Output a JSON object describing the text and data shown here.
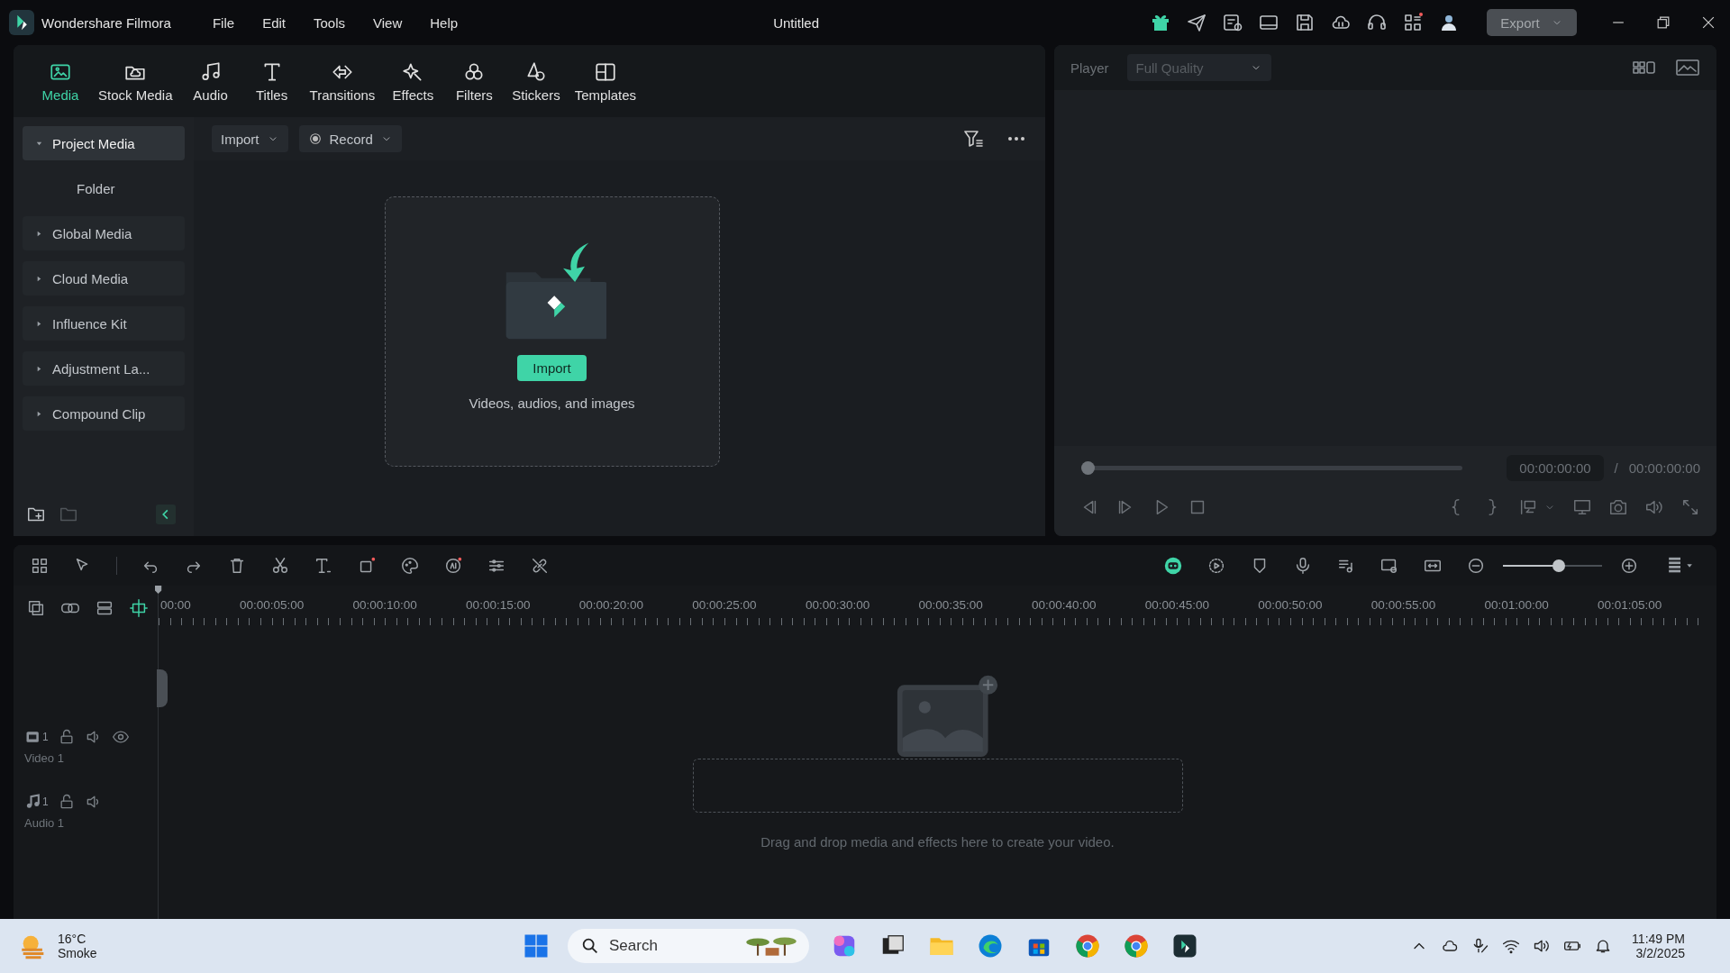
{
  "app": {
    "name": "Wondershare Filmora",
    "menu": [
      "File",
      "Edit",
      "Tools",
      "View",
      "Help"
    ],
    "document_title": "Untitled",
    "export_button": {
      "label": "Export",
      "disabled": true
    }
  },
  "tabs": [
    {
      "label": "Media",
      "selected": true
    },
    {
      "label": "Stock Media",
      "selected": false
    },
    {
      "label": "Audio",
      "selected": false
    },
    {
      "label": "Titles",
      "selected": false
    },
    {
      "label": "Transitions",
      "selected": false
    },
    {
      "label": "Effects",
      "selected": false
    },
    {
      "label": "Filters",
      "selected": false
    },
    {
      "label": "Stickers",
      "selected": false
    },
    {
      "label": "Templates",
      "selected": false
    }
  ],
  "sidebar": {
    "items": [
      {
        "label": "Project Media",
        "expanded": true,
        "selected": true,
        "children": [
          {
            "label": "Folder"
          }
        ]
      },
      {
        "label": "Global Media",
        "expanded": false,
        "selected": false
      },
      {
        "label": "Cloud Media",
        "expanded": false,
        "selected": false
      },
      {
        "label": "Influence Kit",
        "expanded": false,
        "selected": false
      },
      {
        "label": "Adjustment La...",
        "expanded": false,
        "selected": false
      },
      {
        "label": "Compound Clip",
        "expanded": false,
        "selected": false
      }
    ]
  },
  "media_toolbar": {
    "import": "Import",
    "record": "Record"
  },
  "drop_zone": {
    "button": "Import",
    "hint": "Videos, audios, and images"
  },
  "player": {
    "label": "Player",
    "quality": "Full Quality",
    "level": 0,
    "current_time": "00:00:00:00",
    "separator": "/",
    "total_time": "00:00:00:00"
  },
  "timeline": {
    "zoom": {
      "level": 0.56
    },
    "ruler": [
      "00:00",
      "00:00:05:00",
      "00:00:10:00",
      "00:00:15:00",
      "00:00:20:00",
      "00:00:25:00",
      "00:00:30:00",
      "00:00:35:00",
      "00:00:40:00",
      "00:00:45:00",
      "00:00:50:00",
      "00:00:55:00",
      "00:01:00:00",
      "00:01:05:00"
    ],
    "tracks": [
      {
        "kind": "video",
        "number": "1",
        "name": "Video 1"
      },
      {
        "kind": "audio",
        "number": "1",
        "name": "Audio 1"
      }
    ],
    "hint": "Drag and drop media and effects here to create your video."
  },
  "taskbar": {
    "temperature": "16°C",
    "condition": "Smoke",
    "search": "Search",
    "time": "11:49 PM",
    "date": "3/2/2025"
  }
}
